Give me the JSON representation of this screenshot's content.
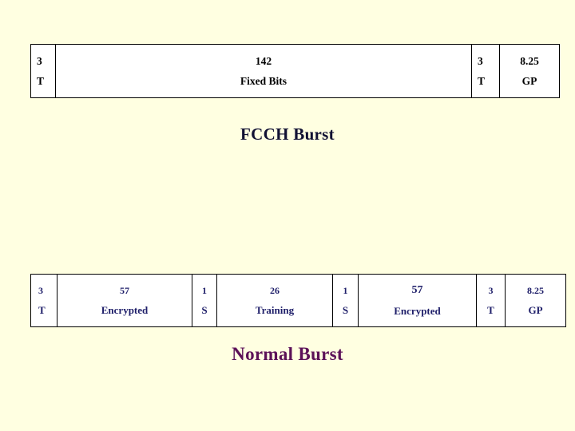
{
  "slide": {
    "background_color": "#FFFFE1",
    "title_fcch": "FCCH Burst",
    "title_normal": "Normal Burst"
  },
  "fcch_burst": {
    "caption": "FCCH Burst",
    "text_color": "#000000",
    "cells": [
      {
        "bits": "3",
        "label": "T",
        "align": "left"
      },
      {
        "bits": "142",
        "label": "Fixed Bits",
        "align": "center"
      },
      {
        "bits": "3",
        "label": "T",
        "align": "left"
      },
      {
        "bits": "8.25",
        "label": "GP",
        "align": "center"
      }
    ]
  },
  "normal_burst": {
    "caption": "Normal Burst",
    "text_color": "#1E1E69",
    "cells": [
      {
        "bits": "3",
        "label": "T",
        "align": "left"
      },
      {
        "bits": "57",
        "label": "Encrypted",
        "align": "center"
      },
      {
        "bits": "1",
        "label": "S",
        "align": "center"
      },
      {
        "bits": "26",
        "label": "Training",
        "align": "center"
      },
      {
        "bits": "1",
        "label": "S",
        "align": "center"
      },
      {
        "bits": "57",
        "label": "Encrypted",
        "align": "center"
      },
      {
        "bits": "3",
        "label": "T",
        "align": "left"
      },
      {
        "bits": "8.25",
        "label": "GP",
        "align": "center"
      }
    ]
  }
}
